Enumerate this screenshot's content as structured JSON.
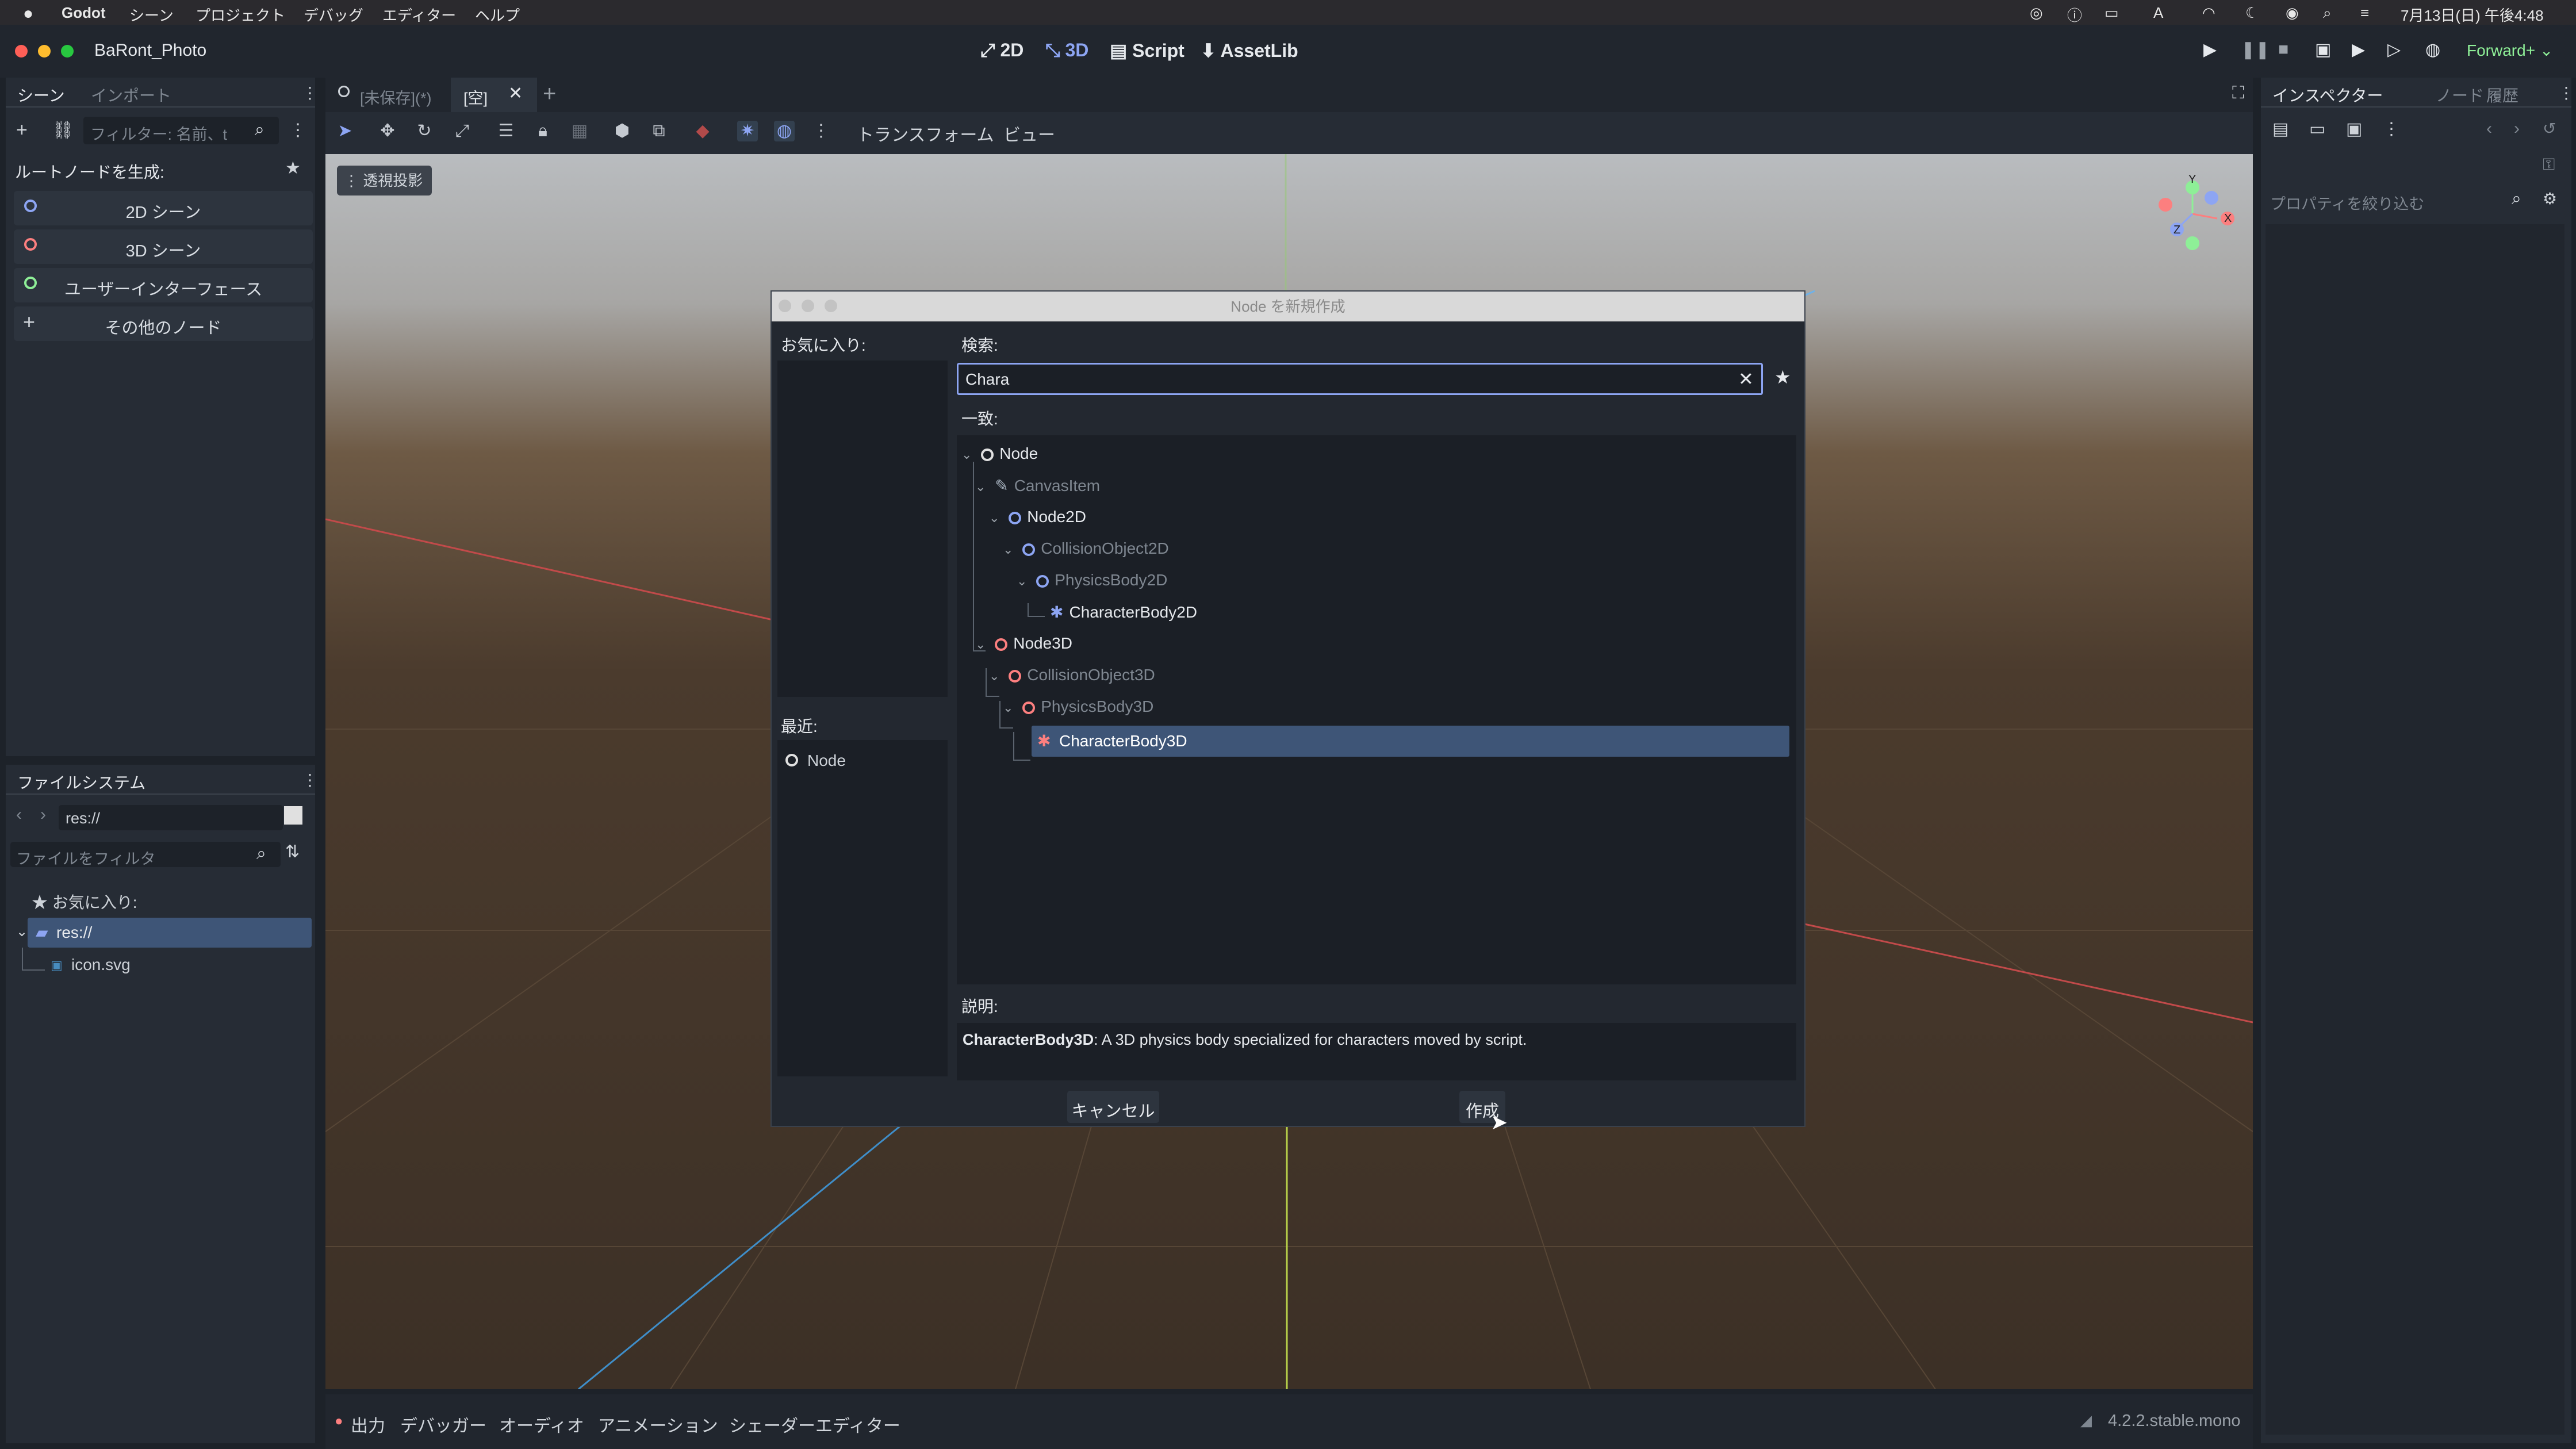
{
  "macmenu": {
    "app": "Godot",
    "items": [
      "シーン",
      "プロジェクト",
      "デバッグ",
      "エディター",
      "ヘルプ"
    ],
    "clock": "7月13日(日) 午後4:48"
  },
  "window": {
    "project": "BaRont_Photo",
    "modes": [
      "2D",
      "3D",
      "Script",
      "AssetLib"
    ],
    "renderer": "Forward+"
  },
  "scene_dock": {
    "tabs": [
      "シーン",
      "インポート"
    ],
    "filter_placeholder": "フィルター: 名前、t",
    "root_header": "ルートノードを生成:",
    "buttons": [
      {
        "label": "2D シーン",
        "color": "#8da5f3"
      },
      {
        "label": "3D シーン",
        "color": "#fc7f7f"
      },
      {
        "label": "ユーザーインターフェース",
        "color": "#8eef97"
      },
      {
        "label": "その他のノード",
        "color": "#e0e0e0"
      }
    ]
  },
  "filesystem": {
    "tab": "ファイルシステム",
    "path": "res://",
    "filter_placeholder": "ファイルをフィルタ",
    "favorites": "お気に入り:",
    "root": "res://",
    "files": [
      "icon.svg"
    ]
  },
  "editor_tabs": [
    "[未保存](*)",
    "[空]"
  ],
  "toolbar": {
    "transform": "トランスフォーム",
    "view": "ビュー"
  },
  "viewport": {
    "perspective": "透視投影"
  },
  "inspector": {
    "tabs": [
      "インスペクター",
      "ノード",
      "履歴"
    ],
    "filter_placeholder": "プロパティを絞り込む"
  },
  "dialog": {
    "title": "Node を新規作成",
    "favorites_label": "お気に入り:",
    "recent_label": "最近:",
    "recent_items": [
      "Node"
    ],
    "search_label": "検索:",
    "search_value": "Chara",
    "match_label": "一致:",
    "tree": [
      {
        "label": "Node",
        "depth": 0,
        "icon": "circle",
        "color": "#e0e0e0",
        "dim": false
      },
      {
        "label": "CanvasItem",
        "depth": 1,
        "icon": "pencil",
        "color": "#a5b0bd",
        "dim": true
      },
      {
        "label": "Node2D",
        "depth": 2,
        "icon": "circle",
        "color": "#8da5f3",
        "dim": false
      },
      {
        "label": "CollisionObject2D",
        "depth": 3,
        "icon": "circle",
        "color": "#8da5f3",
        "dim": true
      },
      {
        "label": "PhysicsBody2D",
        "depth": 4,
        "icon": "circle",
        "color": "#8da5f3",
        "dim": true
      },
      {
        "label": "CharacterBody2D",
        "depth": 5,
        "icon": "char",
        "color": "#8da5f3",
        "dim": false
      },
      {
        "label": "Node3D",
        "depth": 1,
        "icon": "circle",
        "color": "#fc7f7f",
        "dim": false
      },
      {
        "label": "CollisionObject3D",
        "depth": 2,
        "icon": "circle",
        "color": "#fc7f7f",
        "dim": true
      },
      {
        "label": "PhysicsBody3D",
        "depth": 3,
        "icon": "circle",
        "color": "#fc7f7f",
        "dim": true
      },
      {
        "label": "CharacterBody3D",
        "depth": 4,
        "icon": "char",
        "color": "#fc7f7f",
        "dim": false,
        "selected": true
      }
    ],
    "desc_label": "説明:",
    "desc_name": "CharacterBody3D",
    "desc_text": ": A 3D physics body specialized for characters moved by script.",
    "cancel": "キャンセル",
    "create": "作成"
  },
  "bottom_tabs": [
    "出力",
    "デバッガー",
    "オーディオ",
    "アニメーション",
    "シェーダーエディター"
  ],
  "version": "4.2.2.stable.mono"
}
